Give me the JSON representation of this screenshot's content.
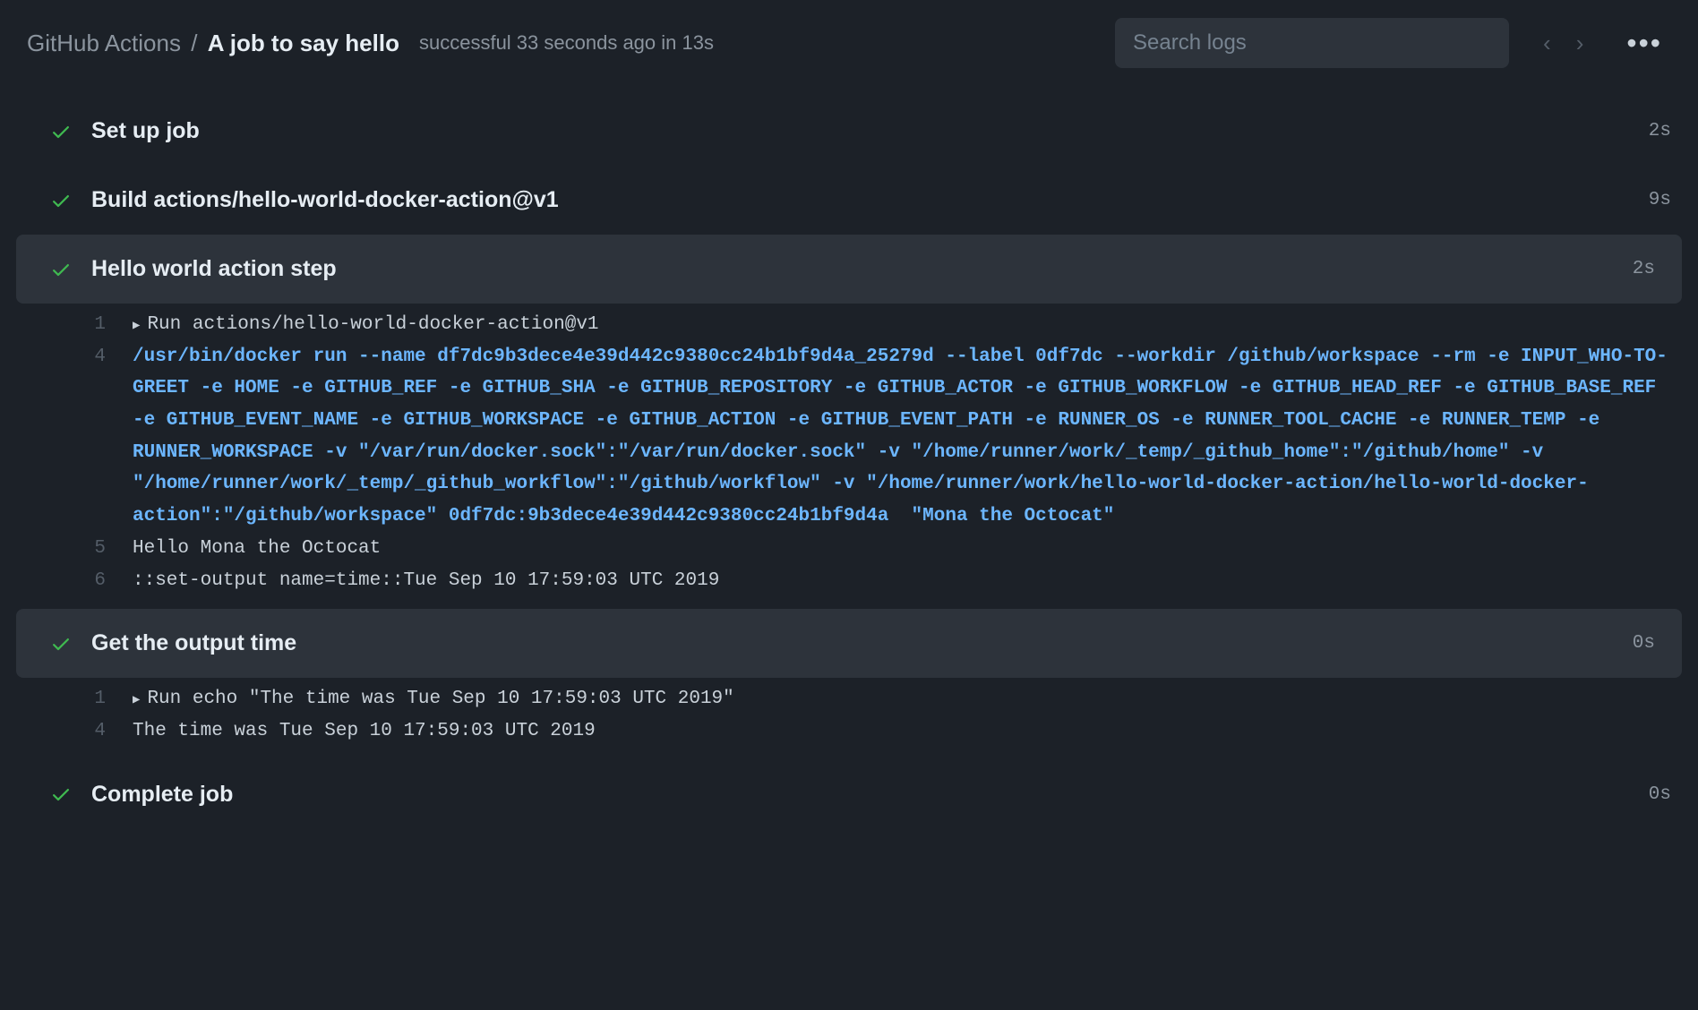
{
  "header": {
    "breadcrumb_parent": "GitHub Actions",
    "breadcrumb_sep": "/",
    "breadcrumb_job": "A job to say hello",
    "status": "successful 33 seconds ago in 13s",
    "search_placeholder": "Search logs",
    "prev_arrow": "‹",
    "next_arrow": "›",
    "kebab": "•••"
  },
  "steps": [
    {
      "title": "Set up job",
      "duration": "2s",
      "expanded": false
    },
    {
      "title": "Build actions/hello-world-docker-action@v1",
      "duration": "9s",
      "expanded": false
    },
    {
      "title": "Hello world action step",
      "duration": "2s",
      "expanded": true,
      "logs": [
        {
          "no": "1",
          "caret": true,
          "text": "Run actions/hello-world-docker-action@v1",
          "blue": false
        },
        {
          "no": "4",
          "caret": false,
          "text": "/usr/bin/docker run --name df7dc9b3dece4e39d442c9380cc24b1bf9d4a_25279d --label 0df7dc --workdir /github/workspace --rm -e INPUT_WHO-TO-GREET -e HOME -e GITHUB_REF -e GITHUB_SHA -e GITHUB_REPOSITORY -e GITHUB_ACTOR -e GITHUB_WORKFLOW -e GITHUB_HEAD_REF -e GITHUB_BASE_REF -e GITHUB_EVENT_NAME -e GITHUB_WORKSPACE -e GITHUB_ACTION -e GITHUB_EVENT_PATH -e RUNNER_OS -e RUNNER_TOOL_CACHE -e RUNNER_TEMP -e RUNNER_WORKSPACE -v \"/var/run/docker.sock\":\"/var/run/docker.sock\" -v \"/home/runner/work/_temp/_github_home\":\"/github/home\" -v \"/home/runner/work/_temp/_github_workflow\":\"/github/workflow\" -v \"/home/runner/work/hello-world-docker-action/hello-world-docker-action\":\"/github/workspace\" 0df7dc:9b3dece4e39d442c9380cc24b1bf9d4a  \"Mona the Octocat\"",
          "blue": true
        },
        {
          "no": "5",
          "caret": false,
          "text": "Hello Mona the Octocat",
          "blue": false
        },
        {
          "no": "6",
          "caret": false,
          "text": "::set-output name=time::Tue Sep 10 17:59:03 UTC 2019",
          "blue": false
        }
      ]
    },
    {
      "title": "Get the output time",
      "duration": "0s",
      "expanded": true,
      "logs": [
        {
          "no": "1",
          "caret": true,
          "text": "Run echo \"The time was Tue Sep 10 17:59:03 UTC 2019\"",
          "blue": false
        },
        {
          "no": "4",
          "caret": false,
          "text": "The time was Tue Sep 10 17:59:03 UTC 2019",
          "blue": false
        }
      ]
    },
    {
      "title": "Complete job",
      "duration": "0s",
      "expanded": false
    }
  ]
}
